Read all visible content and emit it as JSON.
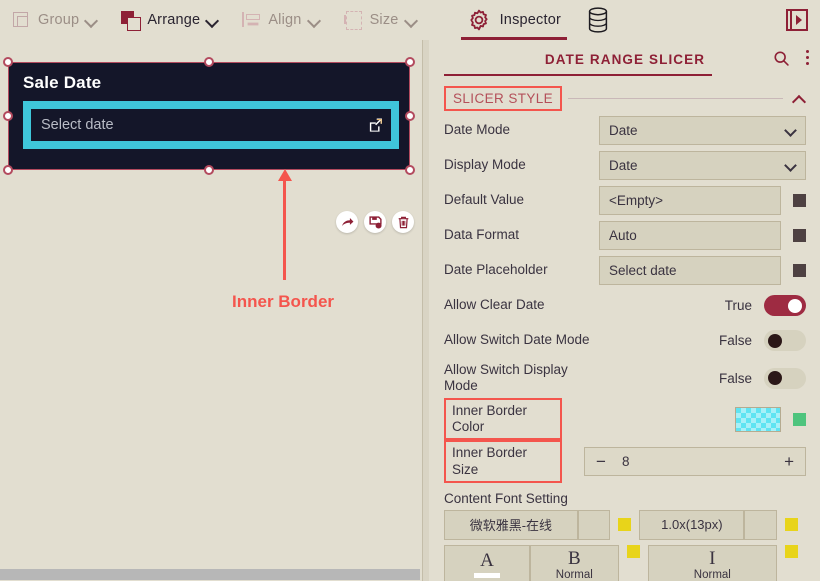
{
  "toolbar": {
    "items": [
      {
        "label": "Group",
        "icon": "group-icon",
        "active": false
      },
      {
        "label": "Arrange",
        "icon": "arrange-icon",
        "active": true
      },
      {
        "label": "Align",
        "icon": "align-icon",
        "active": false
      },
      {
        "label": "Size",
        "icon": "size-icon",
        "active": false
      }
    ],
    "inspector_tab": "Inspector",
    "gear_icon": "gear-icon",
    "database_icon": "database-icon",
    "panel_toggle_icon": "panel-toggle-icon"
  },
  "canvas": {
    "widget": {
      "title": "Sale Date",
      "date_placeholder": "Select date",
      "edit_icon": "edit-square-icon",
      "background": "#141629",
      "inner_border_color": "#3fc6da"
    },
    "mini_actions": [
      {
        "name": "share-button",
        "icon": "share-arrow-icon"
      },
      {
        "name": "save-button",
        "icon": "save-icon"
      },
      {
        "name": "delete-button",
        "icon": "trash-icon"
      }
    ],
    "annotation": {
      "label": "Inner Border",
      "color": "#f4554d"
    }
  },
  "inspector": {
    "title": "DATE RANGE SLICER",
    "search_icon": "search-icon",
    "more_icon": "kebab-menu-icon",
    "accent": "#8e2036",
    "section": {
      "title": "SLICER STYLE",
      "collapse_icon": "chevron-up-icon",
      "highlighted": true
    },
    "rows": [
      {
        "label": "Date Mode",
        "value": "Date",
        "type": "select"
      },
      {
        "label": "Display Mode",
        "value": "Date",
        "type": "select"
      },
      {
        "label": "Default Value",
        "value": "<Empty>",
        "type": "text-with-button"
      },
      {
        "label": "Data Format",
        "value": "Auto",
        "type": "text-with-button"
      },
      {
        "label": "Date Placeholder",
        "value": "Select date",
        "type": "text-with-button"
      }
    ],
    "toggles": [
      {
        "label": "Allow Clear Date",
        "value": "True",
        "on": true
      },
      {
        "label": "Allow Switch Date Mode",
        "value": "False",
        "on": false
      },
      {
        "label": "Allow Switch Display Mode",
        "value": "False",
        "on": false
      }
    ],
    "inner_border_color": {
      "label": "Inner Border Color",
      "swatch_color": "#5fe4f2",
      "indicator_color": "#4ec47d",
      "highlighted": true
    },
    "inner_border_size": {
      "label": "Inner Border Size",
      "value": "8",
      "minus": "−",
      "plus": "+",
      "highlighted": true
    },
    "content_font": {
      "label": "Content Font Setting",
      "font_name": "微软雅黑-在线",
      "font_size": "1.0x(13px)",
      "indicator_color": "#e8d41a",
      "styles": [
        {
          "glyph": "A",
          "sub": "",
          "name": "font-color-button",
          "colorbar": "#ffffff"
        },
        {
          "glyph": "B",
          "sub": "Normal",
          "name": "font-weight-button",
          "colorbar": ""
        },
        {
          "glyph": "I",
          "sub": "Normal",
          "name": "font-style-button",
          "colorbar": ""
        }
      ]
    }
  }
}
